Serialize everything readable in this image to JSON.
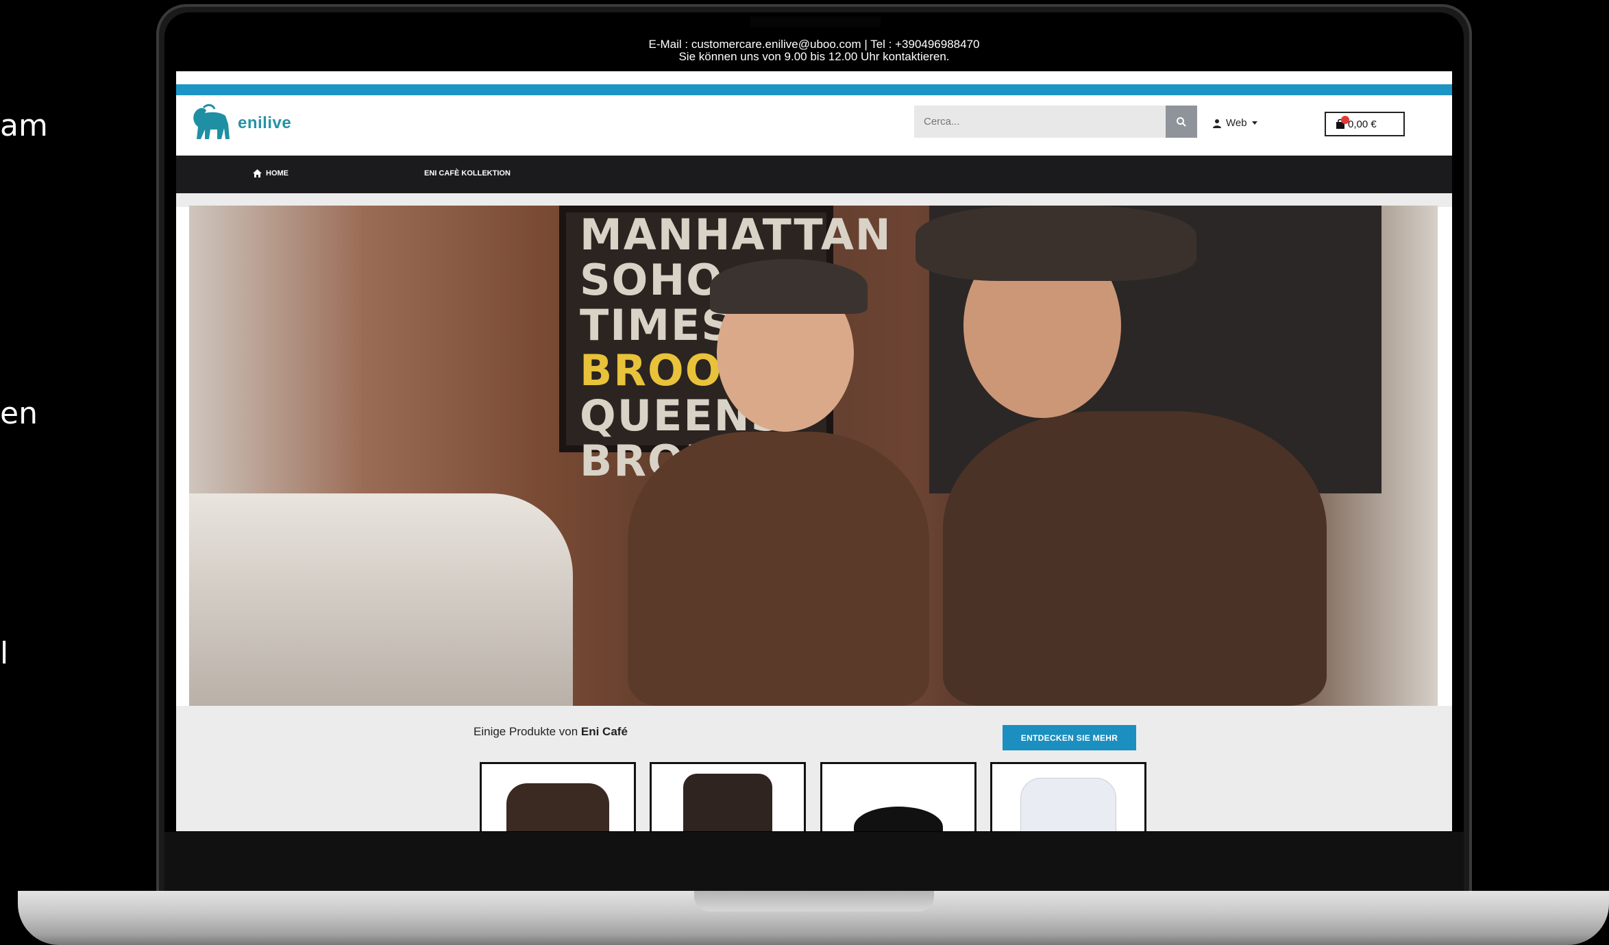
{
  "side_fragments": [
    "am",
    "en",
    "l"
  ],
  "topbar": {
    "line1": "E-Mail : customercare.enilive@uboo.com | Tel : +390496988470",
    "line2": "Sie können uns von 9.00 bis 12.00 Uhr kontaktieren."
  },
  "header": {
    "logo_text": "enilive",
    "search_placeholder": "Cerca...",
    "user_label": "Web",
    "cart_total": "0,00 €"
  },
  "nav": {
    "items": [
      {
        "label": "HOME",
        "icon": "home-icon"
      },
      {
        "label": "ENI CAFÈ KOLLEKTION"
      }
    ]
  },
  "hero": {
    "sign_lines": [
      "MANHATTAN",
      "SOHO TIMES",
      "BROOKLYN",
      "QUEENS",
      "BRONX"
    ]
  },
  "products": {
    "title_prefix": "Einige Produkte von ",
    "title_bold": "Eni Café",
    "discover_button": "ENTDECKEN SIE MEHR"
  },
  "colors": {
    "accent_blue": "#1b95c4",
    "nav_dark": "#1b1b1d",
    "logo_teal": "#2493a6"
  }
}
